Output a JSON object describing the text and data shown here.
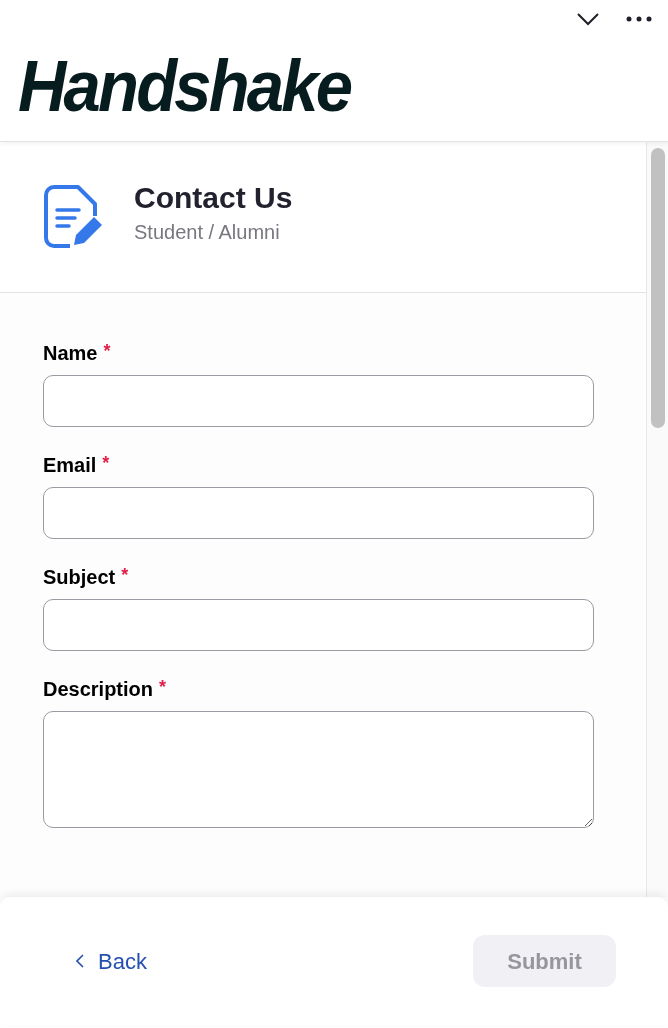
{
  "logo": "Handshake",
  "header": {
    "title": "Contact Us",
    "subtitle": "Student / Alumni"
  },
  "fields": [
    {
      "kind": "input",
      "label": "Name",
      "required": true
    },
    {
      "kind": "input",
      "label": "Email",
      "required": true
    },
    {
      "kind": "input",
      "label": "Subject",
      "required": true
    },
    {
      "kind": "textarea",
      "label": "Description",
      "required": true
    }
  ],
  "required_mark": "*",
  "footer": {
    "back": "Back",
    "submit": {
      "label": "Submit",
      "disabled": true
    }
  }
}
